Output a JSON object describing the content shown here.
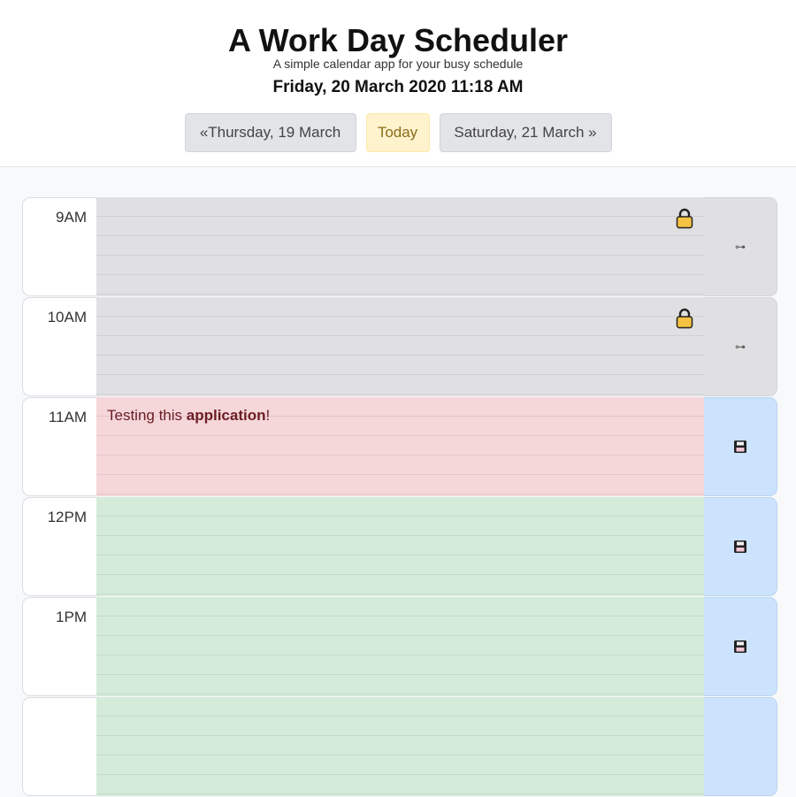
{
  "header": {
    "title": "A Work Day Scheduler",
    "subtitle": "A simple calendar app for your busy schedule",
    "datetime": "Friday, 20 March 2020 11:18 AM"
  },
  "nav": {
    "prev_label": "«Thursday, 19 March",
    "today_label": "Today",
    "next_label": "Saturday, 21 March »"
  },
  "schedule": [
    {
      "hour": "9AM",
      "state": "past",
      "text_plain": "",
      "text_bold": "",
      "text_tail": "",
      "locked": true
    },
    {
      "hour": "10AM",
      "state": "past",
      "text_plain": "",
      "text_bold": "",
      "text_tail": "",
      "locked": true
    },
    {
      "hour": "11AM",
      "state": "present",
      "text_plain": "Testing this ",
      "text_bold": "application",
      "text_tail": "!",
      "locked": false
    },
    {
      "hour": "12PM",
      "state": "future",
      "text_plain": "",
      "text_bold": "",
      "text_tail": "",
      "locked": false
    },
    {
      "hour": "1PM",
      "state": "future",
      "text_plain": "",
      "text_bold": "",
      "text_tail": "",
      "locked": false
    }
  ],
  "icons": {
    "lock": "lock-icon",
    "key": "key-icon",
    "save": "floppy-disk-icon"
  },
  "colors": {
    "past": "#e0e0e2",
    "present": "#f5d6d9",
    "future": "#d4ebda",
    "save_active": "#cbe3fd",
    "today_button": "#fff3cd"
  }
}
